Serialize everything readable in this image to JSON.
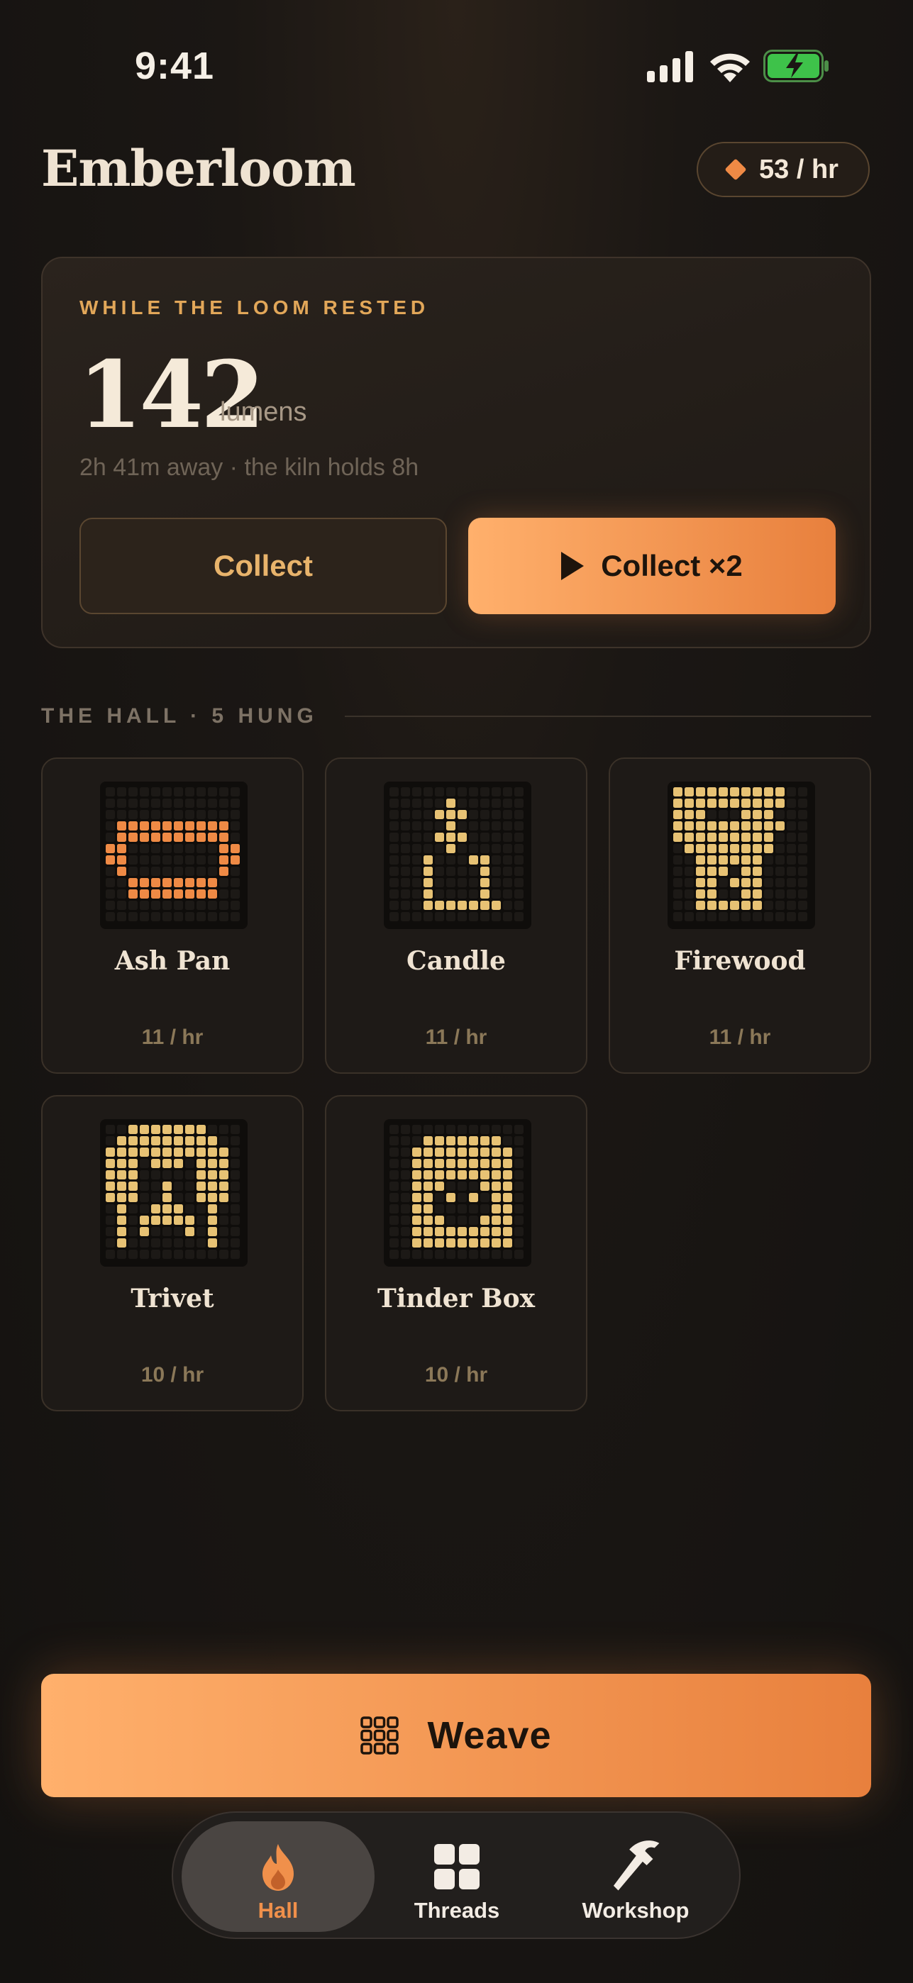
{
  "status_bar": {
    "time": "9:41"
  },
  "header": {
    "title": "Emberloom",
    "rate": "53 / hr"
  },
  "rest_card": {
    "eyebrow": "WHILE THE LOOM RESTED",
    "amount": "142",
    "unit": "lumens",
    "subtitle": "2h 41m away · the kiln holds 8h",
    "collect_label": "Collect",
    "collect_double_label": "Collect ×2"
  },
  "hall": {
    "section_label": "THE HALL · 5 HUNG",
    "items": [
      {
        "name": "Ash Pan",
        "rate": "11 / hr",
        "icon": "ash-pan-icon",
        "color": "#ef8a45"
      },
      {
        "name": "Candle",
        "rate": "11 / hr",
        "icon": "candle-icon",
        "color": "#e7c274"
      },
      {
        "name": "Firewood",
        "rate": "11 / hr",
        "icon": "firewood-icon",
        "color": "#e7c274"
      },
      {
        "name": "Trivet",
        "rate": "10 / hr",
        "icon": "trivet-icon",
        "color": "#e7c274"
      },
      {
        "name": "Tinder Box",
        "rate": "10 / hr",
        "icon": "tinder-box-icon",
        "color": "#e7c274"
      }
    ]
  },
  "weave_button": {
    "label": "Weave"
  },
  "tabbar": {
    "tabs": [
      {
        "label": "Hall",
        "icon": "flame-icon",
        "active": true
      },
      {
        "label": "Threads",
        "icon": "grid-icon",
        "active": false
      },
      {
        "label": "Workshop",
        "icon": "hammer-icon",
        "active": false
      }
    ]
  },
  "colors": {
    "accent": "#ef8a45",
    "gold": "#e7c274",
    "background": "#141210"
  }
}
